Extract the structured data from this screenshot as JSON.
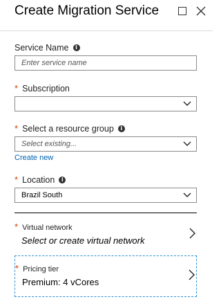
{
  "window": {
    "title": "Create Migration Service"
  },
  "service_name": {
    "label": "Service Name",
    "placeholder": "Enter service name",
    "value": ""
  },
  "subscription": {
    "label": "Subscription",
    "value": ""
  },
  "resource_group": {
    "label": "Select a resource group",
    "placeholder": "Select existing...",
    "create_new": "Create new"
  },
  "location": {
    "label": "Location",
    "value": "Brazil South"
  },
  "virtual_network": {
    "label": "Virtual network",
    "value": "Select or create virtual network"
  },
  "pricing_tier": {
    "label": "Pricing tier",
    "value": "Premium: 4 vCores"
  },
  "required_mark": "*",
  "colors": {
    "required": "#d83b01",
    "link": "#0063b1",
    "focus_border": "#2b8fd6"
  }
}
